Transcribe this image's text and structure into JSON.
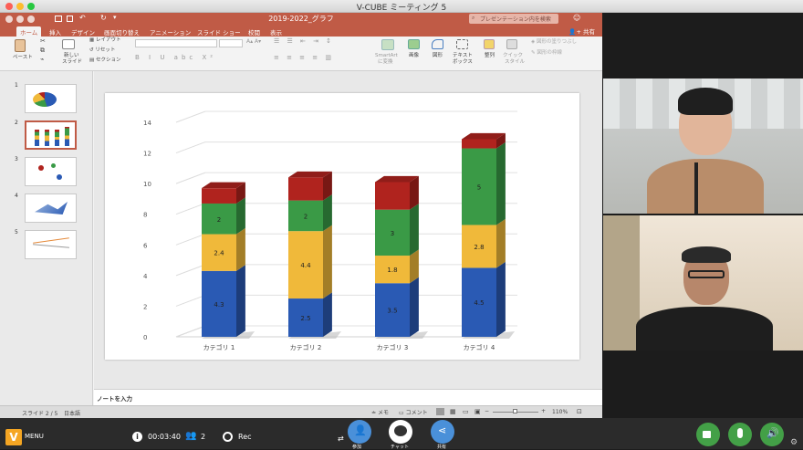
{
  "app": {
    "title": "V-CUBE ミーティング 5"
  },
  "ppt": {
    "doc_title": "2019-2022_グラフ",
    "search_placeholder": "プレゼンテーション内を検索",
    "share": "共有",
    "tabs": [
      "ホーム",
      "挿入",
      "デザイン",
      "画面切り替え",
      "アニメーション",
      "スライド ショー",
      "校閲",
      "表示"
    ],
    "ribbon": {
      "paste": "ペースト",
      "new_slide_1": "新しい",
      "new_slide_2": "スライド",
      "layout": "レイアウト",
      "reset": "リセット",
      "section": "セクション",
      "smartart_1": "SmartArt",
      "smartart_2": "に変換",
      "picture": "画像",
      "shape": "図形",
      "textbox_1": "テキスト",
      "textbox_2": "ボックス",
      "arrange": "整列",
      "quick_1": "クイック",
      "quick_2": "スタイル",
      "shape_fill": "図形の塗りつぶし",
      "shape_outline": "図形の枠線"
    },
    "slide_numbers": [
      "1",
      "2",
      "3",
      "4",
      "5"
    ],
    "notes": "ノートを入力",
    "status": {
      "slide": "スライド 2 / 5",
      "lang": "日本語",
      "memo": "メモ",
      "comment": "コメント",
      "zoom": "110%"
    }
  },
  "chart_data": {
    "type": "bar",
    "stacked": true,
    "categories": [
      "カテゴリ 1",
      "カテゴリ 2",
      "カテゴリ 3",
      "カテゴリ 4"
    ],
    "series": [
      {
        "values": [
          4.3,
          2.5,
          3.5,
          4.5
        ],
        "color": "#2a5ab4"
      },
      {
        "values": [
          2.4,
          4.4,
          1.8,
          2.8
        ],
        "color": "#f0b93a"
      },
      {
        "values": [
          2,
          2,
          3,
          5
        ],
        "color": "#3a9a46"
      },
      {
        "values": [
          1,
          1.5,
          1.8,
          0.6
        ],
        "color": "#b0231e"
      }
    ],
    "data_labels": [
      [
        "4.3",
        "2.5",
        "3.5",
        "4.5"
      ],
      [
        "2.4",
        "4.4",
        "1.8",
        "2.8"
      ],
      [
        "2",
        "2",
        "3",
        "5"
      ],
      [
        "",
        "",
        "",
        ""
      ]
    ],
    "yticks": [
      "0",
      "2",
      "4",
      "6",
      "8",
      "10",
      "12",
      "14"
    ],
    "ylim": [
      0,
      14
    ],
    "grid": true
  },
  "toolbar": {
    "menu": "MENU",
    "time": "00:03:40",
    "participants": "2",
    "rec": "Rec",
    "lbl_participants": "参加",
    "lbl_chat": "チャット",
    "lbl_share": "共有"
  }
}
